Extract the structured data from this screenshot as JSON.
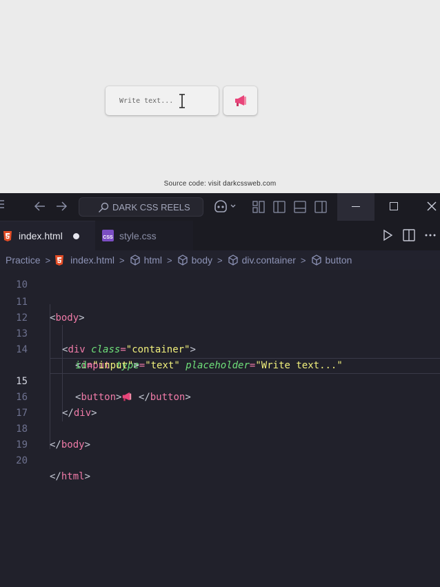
{
  "preview": {
    "input_placeholder": "Write text...",
    "button_icon": "megaphone-icon",
    "source_note": "Source code: visit darkcssweb.com"
  },
  "titlebar": {
    "search_label": "DARK CSS REELS"
  },
  "tabs": [
    {
      "label": "index.html",
      "icon": "html5-icon",
      "modified": true,
      "active": true
    },
    {
      "label": "style.css",
      "icon": "css-icon",
      "modified": false,
      "active": false
    }
  ],
  "breadcrumb": [
    "Practice",
    "index.html",
    "html",
    "body",
    "div.container",
    "button"
  ],
  "editor": {
    "current_line": 15,
    "lines": [
      {
        "num": "10",
        "text": ""
      },
      {
        "num": "11",
        "text": "<body>"
      },
      {
        "num": "12",
        "text": ""
      },
      {
        "num": "13",
        "text": "<div class=\"container\">"
      },
      {
        "num": "14",
        "text": "<input type=\"text\" placeholder=\"Write text...\""
      },
      {
        "num": "",
        "text": "id=\"input\">"
      },
      {
        "num": "15",
        "text": "<button>📢 </button>"
      },
      {
        "num": "16",
        "text": "</div>"
      },
      {
        "num": "17",
        "text": ""
      },
      {
        "num": "18",
        "text": "</body>"
      },
      {
        "num": "19",
        "text": ""
      },
      {
        "num": "20",
        "text": "</html>"
      }
    ]
  },
  "colors": {
    "tag": "#f07ba8",
    "attribute": "#6fe07a",
    "string": "#f1f07c",
    "editor_bg": "#21212b",
    "preview_bg": "#ebebeb"
  }
}
